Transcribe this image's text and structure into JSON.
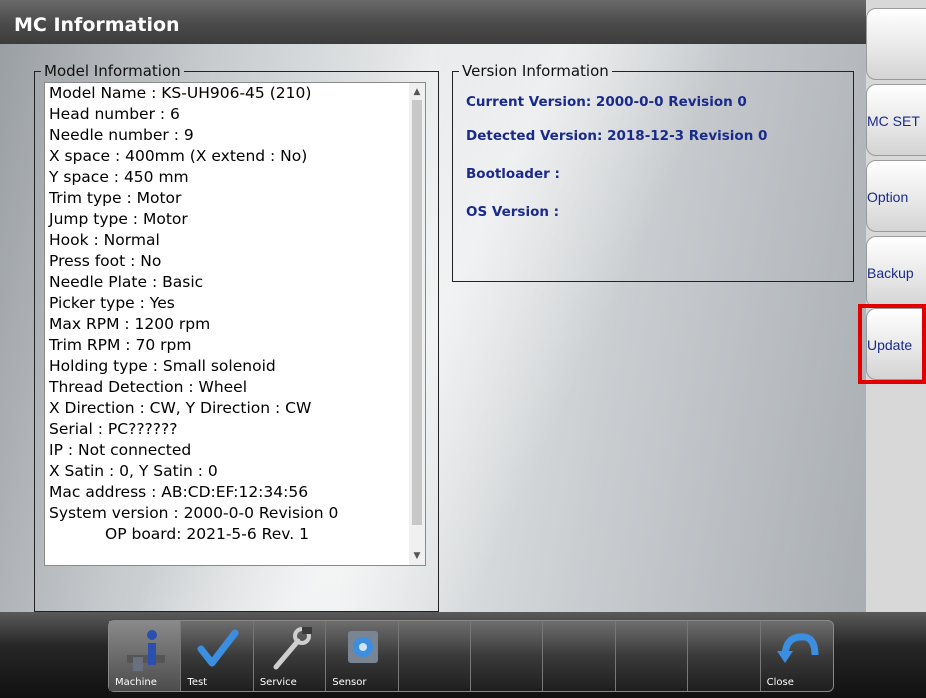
{
  "window": {
    "title": "MC Information"
  },
  "model_info": {
    "legend": "Model Information",
    "lines": [
      "Model Name : KS-UH906-45 (210)",
      "Head number : 6",
      "Needle number : 9",
      "X space : 400mm (X extend : No)",
      "Y space : 450 mm",
      "Trim type : Motor",
      "Jump type : Motor",
      "Hook : Normal",
      "Press foot : No",
      "Needle Plate : Basic",
      "Picker type : Yes",
      "Max RPM : 1200 rpm",
      "Trim RPM : 70 rpm",
      "Holding type : Small solenoid",
      "Thread Detection : Wheel",
      "X Direction : CW, Y Direction : CW",
      "Serial : PC??????",
      "IP : Not connected",
      "X Satin : 0, Y Satin : 0",
      "Mac address : AB:CD:EF:12:34:56",
      "System version : 2000-0-0 Revision 0",
      "OP board: 2021-5-6 Rev. 1"
    ]
  },
  "version_info": {
    "legend": "Version Information",
    "current": "Current Version: 2000-0-0 Revision 0",
    "detected": "Detected Version: 2018-12-3 Revision 0",
    "bootloader": "Bootloader :",
    "os": "OS Version :"
  },
  "side_buttons": {
    "top": "",
    "mc_setting": "MC SET",
    "option": "Option",
    "backup": "Backup",
    "update": "Update"
  },
  "toolbar": {
    "machine": "Machine",
    "test": "Test",
    "service": "Service",
    "sensor": "Sensor",
    "close": "Close"
  },
  "colors": {
    "accent_text": "#1a2a8c",
    "highlight": "#e00000"
  }
}
